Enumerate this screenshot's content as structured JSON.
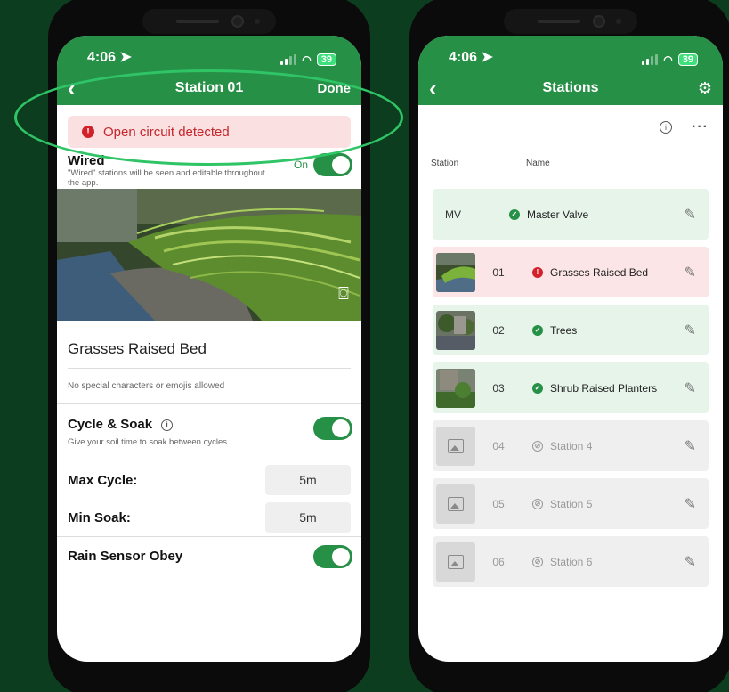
{
  "left": {
    "time": "4:06",
    "battery": "39",
    "nav": {
      "back": "‹",
      "title": "Station 01",
      "done": "Done"
    },
    "alert": {
      "icon": "!",
      "text": "Open circuit detected"
    },
    "wired": {
      "label": "Wired",
      "sub": "\"Wired\" stations will be seen and editable throughout the app.",
      "state": "On"
    },
    "name_value": "Grasses Raised Bed",
    "name_hint": "No special characters or emojis allowed",
    "cycle_soak": {
      "label": "Cycle & Soak",
      "info": "i",
      "sub": "Give your soil time to soak between cycles"
    },
    "max_cycle": {
      "label": "Max Cycle:",
      "value": "5m"
    },
    "min_soak": {
      "label": "Min Soak:",
      "value": "5m"
    },
    "rain_sensor": {
      "label": "Rain Sensor Obey"
    }
  },
  "right": {
    "time": "4:06",
    "battery": "39",
    "nav": {
      "back": "‹",
      "title": "Stations"
    },
    "toolbar": {
      "info": "i",
      "more": "···"
    },
    "columns": {
      "station": "Station",
      "name": "Name"
    },
    "stations": [
      {
        "num": "MV",
        "name": "Master Valve",
        "status": "ok",
        "thumb": "none"
      },
      {
        "num": "01",
        "name": "Grasses Raised Bed",
        "status": "err",
        "thumb": "grass"
      },
      {
        "num": "02",
        "name": "Trees",
        "status": "ok",
        "thumb": "trees"
      },
      {
        "num": "03",
        "name": "Shrub Raised Planters",
        "status": "ok",
        "thumb": "shrub"
      },
      {
        "num": "04",
        "name": "Station 4",
        "status": "off",
        "thumb": "placeholder"
      },
      {
        "num": "05",
        "name": "Station 5",
        "status": "off",
        "thumb": "placeholder"
      },
      {
        "num": "06",
        "name": "Station 6",
        "status": "off",
        "thumb": "placeholder"
      }
    ]
  },
  "colors": {
    "brand": "#279047",
    "error": "#d3212b",
    "highlight": "#2fc567",
    "background": "#0d3d1f"
  }
}
